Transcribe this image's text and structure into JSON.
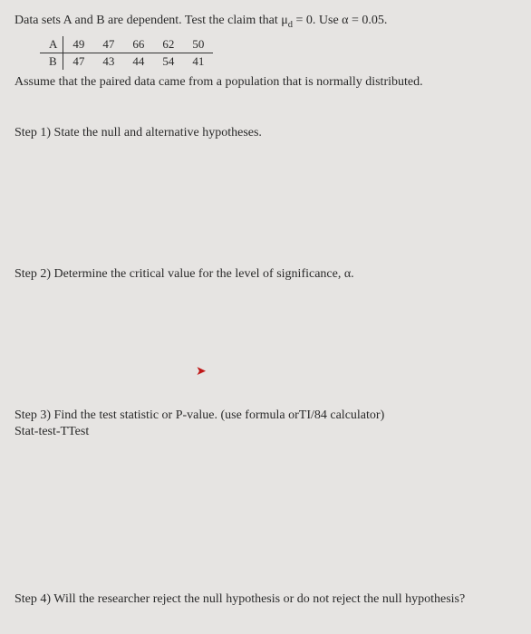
{
  "problem": {
    "intro_html": "Data sets A and B are dependent. Test the claim that μ<sub>d</sub> = 0. Use α = 0.05.",
    "table": {
      "rows": [
        {
          "label": "A",
          "values": [
            "49",
            "47",
            "66",
            "62",
            "50"
          ]
        },
        {
          "label": "B",
          "values": [
            "47",
            "43",
            "44",
            "54",
            "41"
          ]
        }
      ]
    },
    "assume": "Assume that the paired data came from a population that is normally distributed."
  },
  "steps": {
    "s1": "Step 1) State the null and alternative hypotheses.",
    "s2": "Step 2) Determine the critical value for the level of significance, α.",
    "s3": "Step 3) Find the test statistic or P-value. (use formula orTI/84 calculator)",
    "s3_sub": "Stat-test-TTest",
    "s4": "Step 4) Will the researcher reject the null hypothesis or do not reject  the null hypothesis?"
  }
}
